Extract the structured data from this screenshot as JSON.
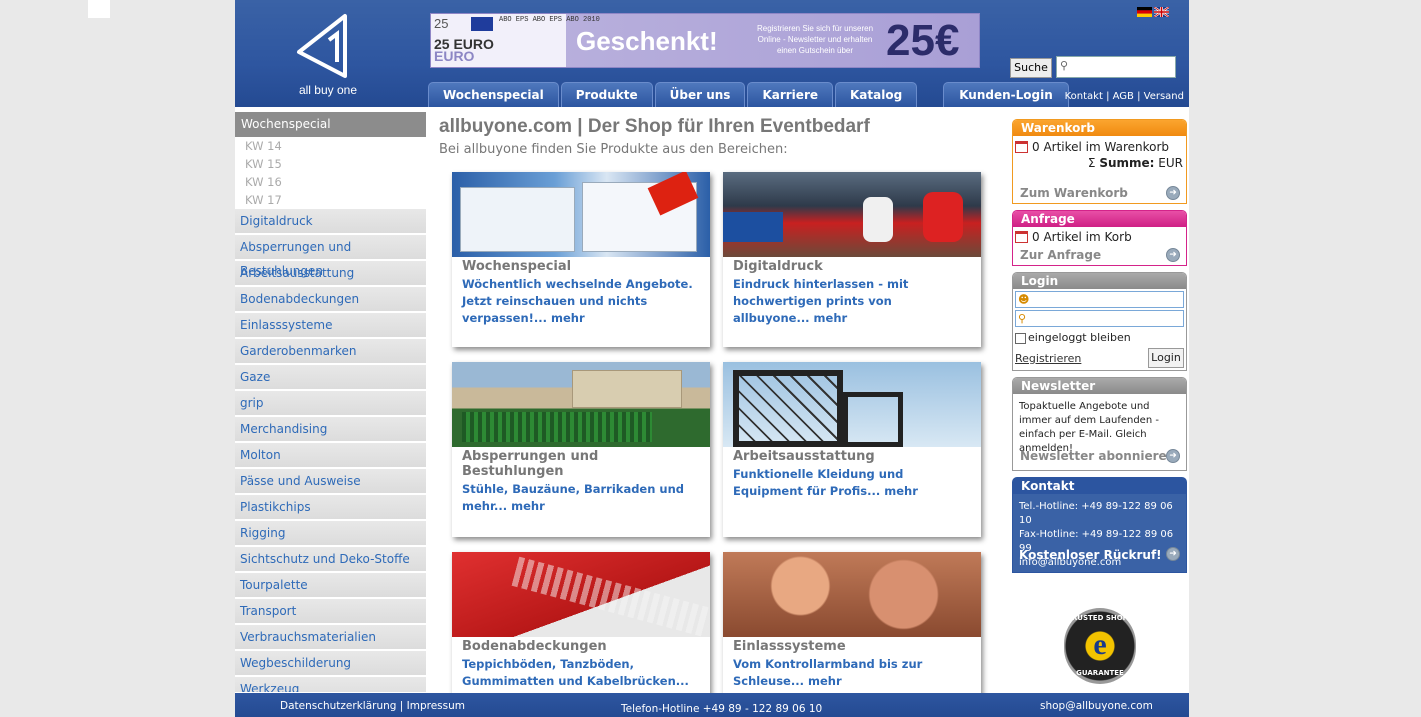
{
  "header": {
    "logo_text": "all buy one",
    "banner": {
      "left_number": "25",
      "abo_strip": "ABO EPS ABO EPS ABO 2010",
      "euro_top": "25 EURO",
      "euro_bottom": "EURO",
      "headline": "Geschenkt!",
      "promo_text": "Registrieren Sie sich für unseren Online - Newsletter und erhalten einen Gutschein über",
      "amount": "25€"
    },
    "nav": [
      "Wochenspecial",
      "Produkte",
      "Über uns",
      "Karriere",
      "Katalog"
    ],
    "login_tab": "Kunden-Login",
    "search_button": "Suche",
    "search_placeholder": "",
    "top_links": {
      "kontakt": "Kontakt",
      "agb": "AGB",
      "versand": "Versand",
      "sep": " | "
    }
  },
  "sidebar": {
    "heading": "Wochenspecial",
    "weeks": [
      "KW 14",
      "KW 15",
      "KW 16",
      "KW 17"
    ],
    "items": [
      "Digitaldruck",
      "Absperrungen und Bestuhlungen",
      "Arbeitsausstattung",
      "Bodenabdeckungen",
      "Einlasssysteme",
      "Garderobenmarken",
      "Gaze",
      "grip",
      "Merchandising",
      "Molton",
      "Pässe und Ausweise",
      "Plastikchips",
      "Rigging",
      "Sichtschutz und Deko-Stoffe",
      "Tourpalette",
      "Transport",
      "Verbrauchsmaterialien",
      "Wegbeschilderung",
      "Werkzeug"
    ]
  },
  "main": {
    "title": "allbuyone.com | Der Shop für Ihren Eventbedarf",
    "subtitle": "Bei allbuyone finden Sie Produkte aus den Bereichen:",
    "cards": [
      {
        "title": "Wochenspecial",
        "desc": "Wöchentlich wechselnde Angebote. Jetzt reinschauen und nichts verpassen!... mehr"
      },
      {
        "title": "Digitaldruck",
        "desc": "Eindruck hinterlassen - mit hochwertigen prints von allbuyone... mehr"
      },
      {
        "title": "Absperrungen und Bestuhlungen",
        "desc": "Stühle, Bauzäune, Barrikaden und mehr... mehr"
      },
      {
        "title": "Arbeitsausstattung",
        "desc": "Funktionelle Kleidung und Equipment für Profis... mehr"
      },
      {
        "title": "Bodenabdeckungen",
        "desc": "Teppichböden, Tanzböden, Gummimatten und Kabelbrücken... mehr"
      },
      {
        "title": "Einlasssysteme",
        "desc": "Vom Kontrollarmband bis zur Schleuse... mehr"
      }
    ]
  },
  "right": {
    "cart": {
      "title": "Warenkorb",
      "count_text": "0 Artikel im Warenkorb",
      "sum_label": "Summe:",
      "currency": "EUR",
      "link": "Zum Warenkorb"
    },
    "inquiry": {
      "title": "Anfrage",
      "count_text": "0 Artikel im Korb",
      "link": "Zur Anfrage"
    },
    "login": {
      "title": "Login",
      "remember": "eingeloggt bleiben",
      "register": "Registrieren",
      "button": "Login"
    },
    "newsletter": {
      "title": "Newsletter",
      "text": "Topaktuelle Angebote und immer auf dem Laufenden - einfach per E-Mail. Gleich anmelden!",
      "link": "Newsletter abonnieren"
    },
    "contact": {
      "title": "Kontakt",
      "hotline": "Tel.-Hotline: +49 89-122 89 06 10",
      "fax": "Fax-Hotline: +49 89-122 89 06 99",
      "email": "info@allbuyone.com",
      "callback": "Kostenloser Rückruf!"
    },
    "trusted": {
      "top": "TRUSTED SHOPS",
      "letter": "e",
      "bottom": "GUARANTEE"
    }
  },
  "footer": {
    "links": "Datenschutzerklärung | Impressum",
    "hotline": "Telefon-Hotline +49 89 - 122 89 06 10",
    "email": "shop@allbuyone.com"
  },
  "colors": {
    "brand_blue": "#2e56a0",
    "link_blue": "#2e6ab8",
    "cart_orange": "#f08a10",
    "inquiry_pink": "#cf1f85"
  }
}
